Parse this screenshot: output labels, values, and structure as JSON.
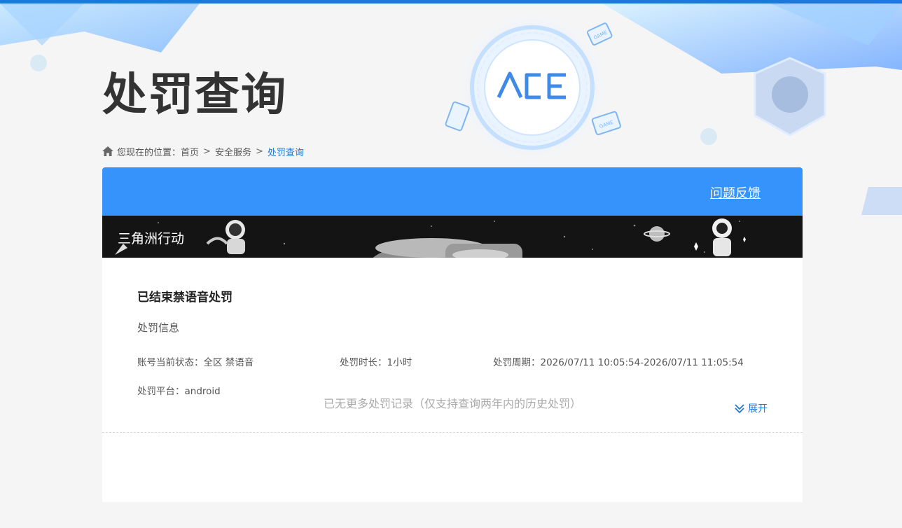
{
  "header": {
    "title": "处罚查询"
  },
  "breadcrumb": {
    "prefix": "您现在的位置：",
    "items": [
      "首页",
      "安全服务",
      "处罚查询"
    ],
    "separator": ">"
  },
  "card": {
    "feedback_label": "问题反馈",
    "game_name": "三角洲行动",
    "record": {
      "title": "已结束禁语音处罚",
      "section_label": "处罚信息",
      "status": "账号当前状态：全区 禁语音",
      "duration": "处罚时长：1小时",
      "period": "处罚周期：2026/07/11 10:05:54-2026/07/11 11:05:54",
      "platform": "处罚平台：android",
      "expand_label": "展开"
    },
    "footer_note": "已无更多处罚记录（仅支持查询两年内的历史处罚）"
  },
  "colors": {
    "accent": "#3593fb",
    "link": "#1e78dc",
    "banner_bg": "#141414"
  },
  "icons": [
    "home-icon",
    "chevron-double-down-icon",
    "ace-logo"
  ]
}
